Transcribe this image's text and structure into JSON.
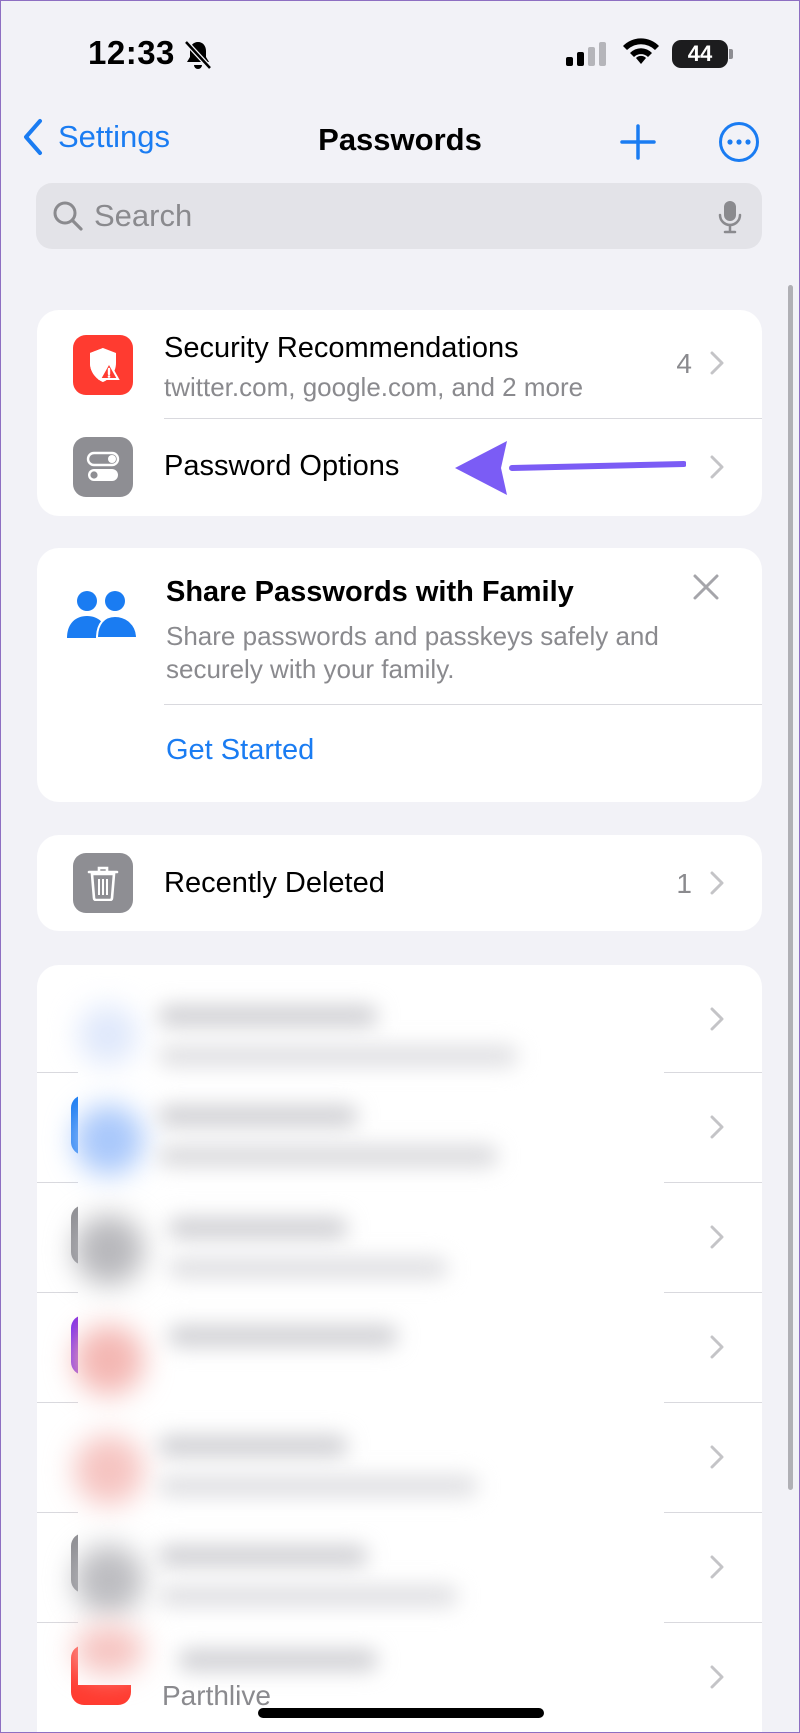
{
  "status_bar": {
    "time": "12:33",
    "battery": "44"
  },
  "nav": {
    "back_label": "Settings",
    "title": "Passwords"
  },
  "search": {
    "placeholder": "Search"
  },
  "security_card": {
    "rows": [
      {
        "title": "Security Recommendations",
        "subtitle": "twitter.com, google.com, and 2 more",
        "count": "4",
        "icon": "shield-warning-icon"
      },
      {
        "title": "Password Options",
        "icon": "toggles-icon"
      }
    ]
  },
  "family_card": {
    "title": "Share Passwords with Family",
    "description": "Share passwords and passkeys safely and securely with your family.",
    "action": "Get Started"
  },
  "deleted_card": {
    "title": "Recently Deleted",
    "count": "1"
  },
  "password_list": {
    "last_visible_text": "Parthlive"
  },
  "colors": {
    "accent": "#1a7cf2",
    "security_red": "#ff3b30",
    "gray_icon": "#8e8e93",
    "annotation_arrow": "#7b5cf5",
    "background": "#f2f2f7"
  }
}
